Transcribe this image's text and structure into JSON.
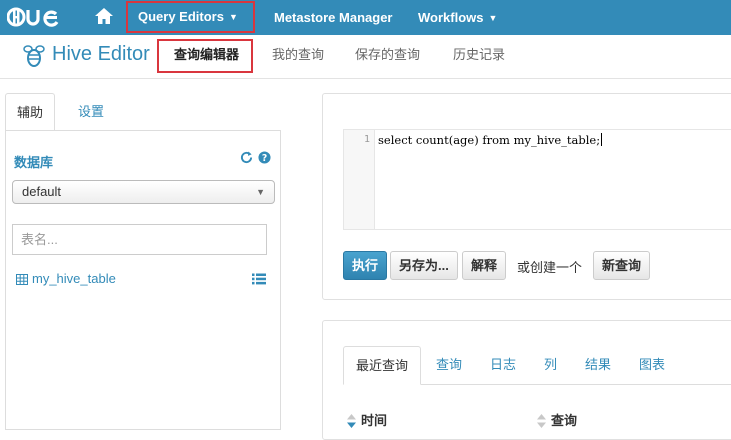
{
  "navbar": {
    "logo": "HUE",
    "home_icon": "home-icon",
    "items": [
      {
        "label": "Query Editors",
        "has_caret": true
      },
      {
        "label": "Metastore Manager",
        "has_caret": false
      },
      {
        "label": "Workflows",
        "has_caret": true
      }
    ],
    "color": "#338bb8"
  },
  "subheader": {
    "app_title": "Hive Editor",
    "app_icon": "hive-bee-icon",
    "tabs": [
      {
        "label": "查询编辑器",
        "active": true
      },
      {
        "label": "我的查询",
        "active": false
      },
      {
        "label": "保存的查询",
        "active": false
      },
      {
        "label": "历史记录",
        "active": false
      }
    ]
  },
  "left_panel": {
    "tabs": [
      {
        "label": "辅助",
        "active": true
      },
      {
        "label": "设置",
        "active": false
      }
    ],
    "database_label": "数据库",
    "refresh_icon": "refresh-icon",
    "help_icon": "help-icon",
    "database_selected": "default",
    "table_filter_placeholder": "表名...",
    "tables": [
      {
        "name": "my_hive_table",
        "icon": "table-icon"
      }
    ]
  },
  "editor": {
    "line_number": "1",
    "code": "select count(age) from my_hive_table;",
    "buttons": {
      "execute": "执行",
      "save_as": "另存为...",
      "explain": "解释",
      "or_create": "或创建一个",
      "new_query": "新查询"
    }
  },
  "results": {
    "tabs": [
      {
        "label": "最近查询",
        "active": true
      },
      {
        "label": "查询",
        "active": false
      },
      {
        "label": "日志",
        "active": false
      },
      {
        "label": "列",
        "active": false
      },
      {
        "label": "结果",
        "active": false
      },
      {
        "label": "图表",
        "active": false
      }
    ],
    "columns": [
      "时间",
      "查询"
    ]
  }
}
